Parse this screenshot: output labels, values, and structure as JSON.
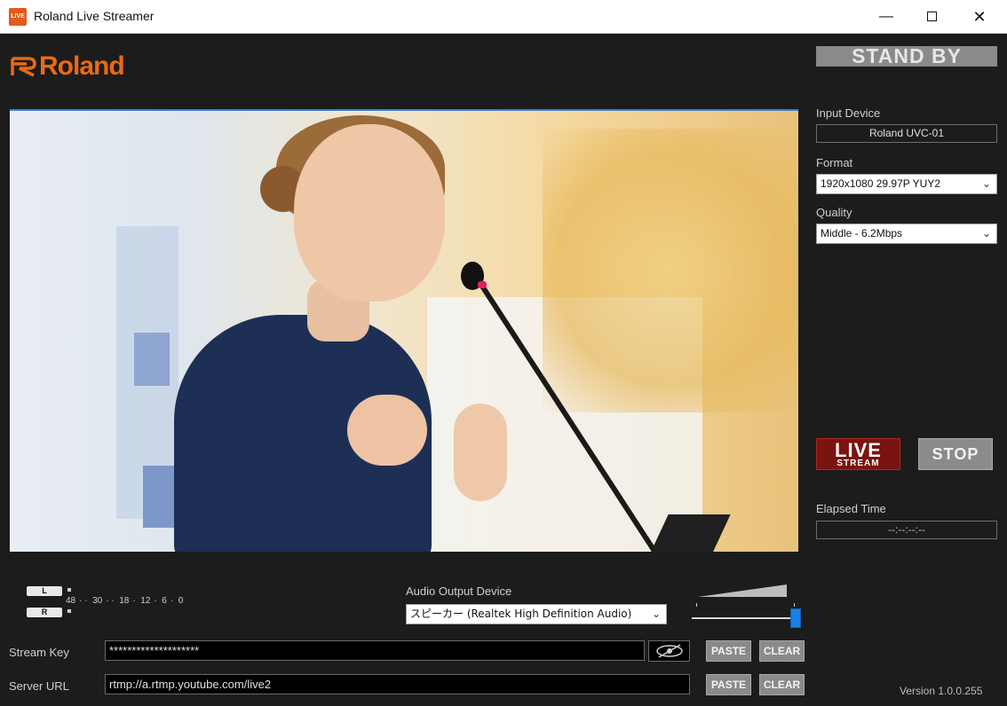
{
  "window": {
    "title": "Roland Live Streamer",
    "app_icon_text": "LIVE",
    "minimize_label": "—",
    "close_label": "✕"
  },
  "brand": {
    "logo_text": "Roland",
    "logo_color": "#ea6a13"
  },
  "status": {
    "text": "STAND BY"
  },
  "right_panel": {
    "input_device_label": "Input Device",
    "input_device_value": "Roland UVC-01",
    "format_label": "Format",
    "format_value": "1920x1080 29.97P YUY2",
    "quality_label": "Quality",
    "quality_value": "Middle - 6.2Mbps",
    "live_button_line1": "LIVE",
    "live_button_line2": "STREAM",
    "stop_button": "STOP",
    "elapsed_label": "Elapsed Time",
    "elapsed_value": "--:--:--:--"
  },
  "meter": {
    "left_label": "L",
    "right_label": "R",
    "scale": [
      "48",
      "30",
      "18",
      "12",
      "6",
      "0"
    ]
  },
  "audio": {
    "output_label": "Audio Output Device",
    "output_value": "スピーカー (Realtek High Definition Audio)",
    "volume_level": 1.0
  },
  "stream": {
    "key_label": "Stream Key",
    "key_value": "********************",
    "url_label": "Server URL",
    "url_value": "rtmp://a.rtmp.youtube.com/live2",
    "paste_label": "PASTE",
    "clear_label": "CLEAR"
  },
  "footer": {
    "version": "Version 1.0.0.255"
  },
  "colors": {
    "accent_blue": "#1a7ee6",
    "live_red": "#7a1410",
    "background": "#1c1c1c"
  },
  "icons": {
    "chevron": "chevron-down-icon",
    "eye": "eye-hidden-icon",
    "close": "close-icon"
  }
}
